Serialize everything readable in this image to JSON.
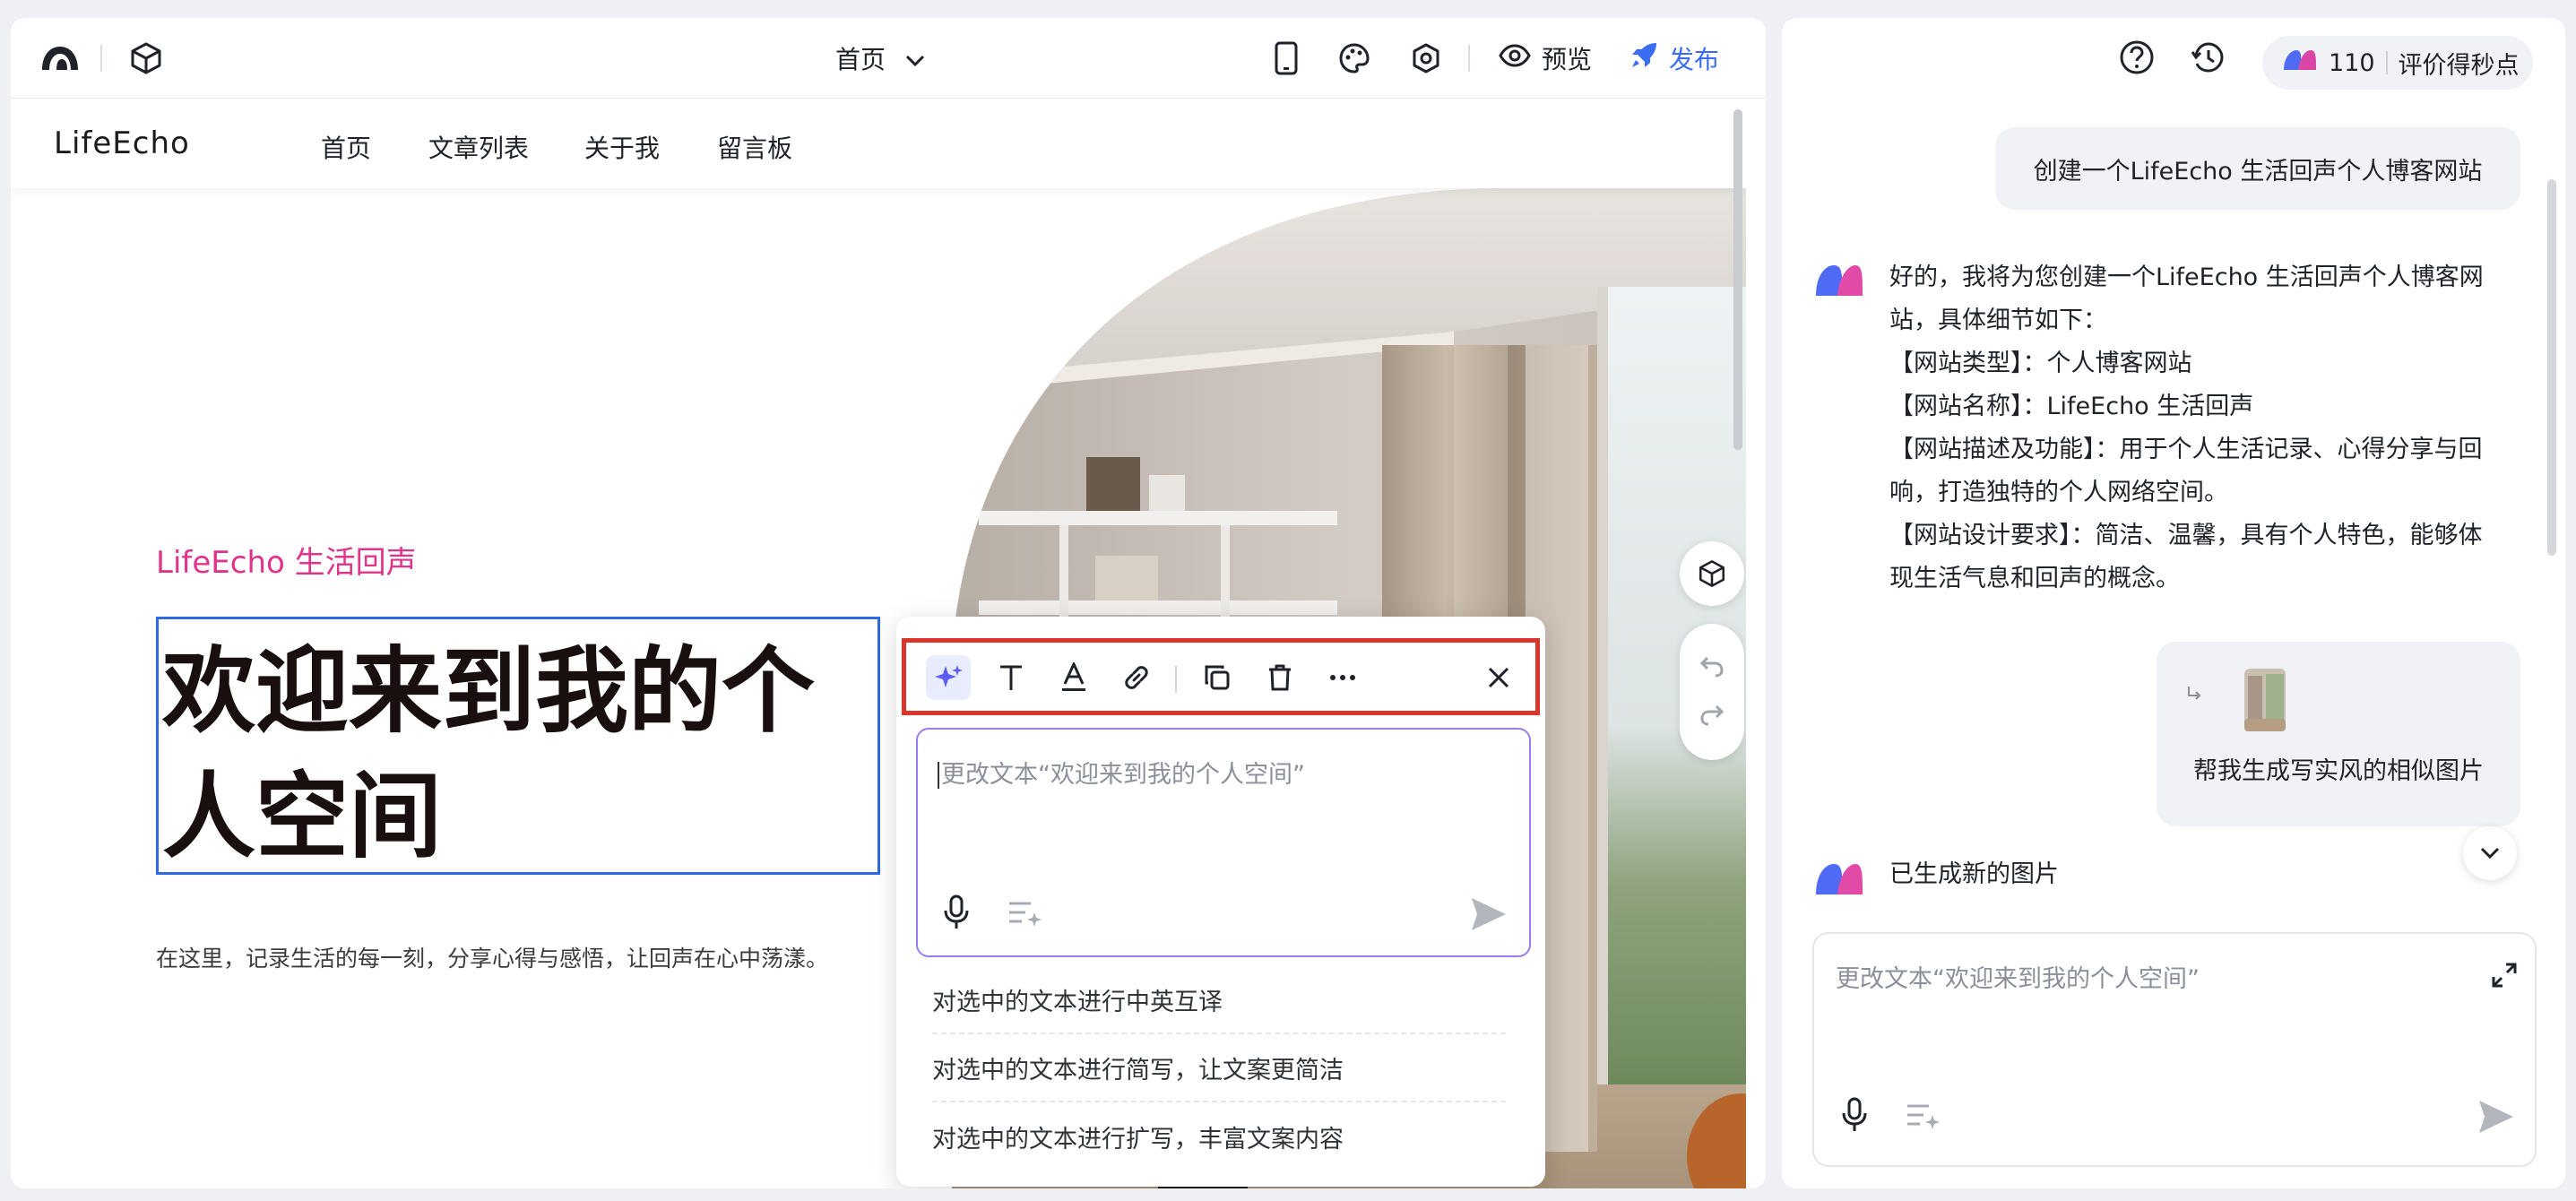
{
  "editor": {
    "page_select": "首页",
    "preview_label": "预览",
    "publish_label": "发布"
  },
  "site": {
    "logo": "LifeEcho",
    "nav": [
      "首页",
      "文章列表",
      "关于我",
      "留言板"
    ],
    "tag": "LifeEcho 生活回声",
    "hero_title": "欢迎来到我的个人空间",
    "hero_subtitle": "在这里，记录生活的每一刻，分享心得与感悟，让回声在心中荡漾。"
  },
  "edit_popover": {
    "input_placeholder": "更改文本“欢迎来到我的个人空间”",
    "suggestions": [
      "对选中的文本进行中英互译",
      "对选中的文本进行简写，让文案更简洁",
      "对选中的文本进行扩写，丰富文案内容"
    ]
  },
  "chat": {
    "credits": "110",
    "credit_label": "评价得秒点",
    "messages": {
      "user1": "创建一个LifeEcho 生活回声个人博客网站",
      "bot1": [
        "好的，我将为您创建一个LifeEcho 生活回声个人博客网",
        "站，具体细节如下：",
        "【网站类型】：个人博客网站",
        "【网站名称】：LifeEcho 生活回声",
        "【网站描述及功能】：用于个人生活记录、心得分享与回",
        "响，打造独特的个人网络空间。",
        "【网站设计要求】：简洁、温馨，具有个人特色，能够体",
        "现生活气息和回声的概念。"
      ],
      "user2": "帮我生成写实风的相似图片",
      "bot2": "已生成新的图片"
    },
    "input_placeholder": "更改文本“欢迎来到我的个人空间”"
  },
  "colors": {
    "accent_blue": "#3b6cf6",
    "selection_blue": "#2e67e5",
    "highlight_red": "#d9362b",
    "tag_pink": "#e0348a",
    "ai_purple": "#9a7cf0"
  }
}
